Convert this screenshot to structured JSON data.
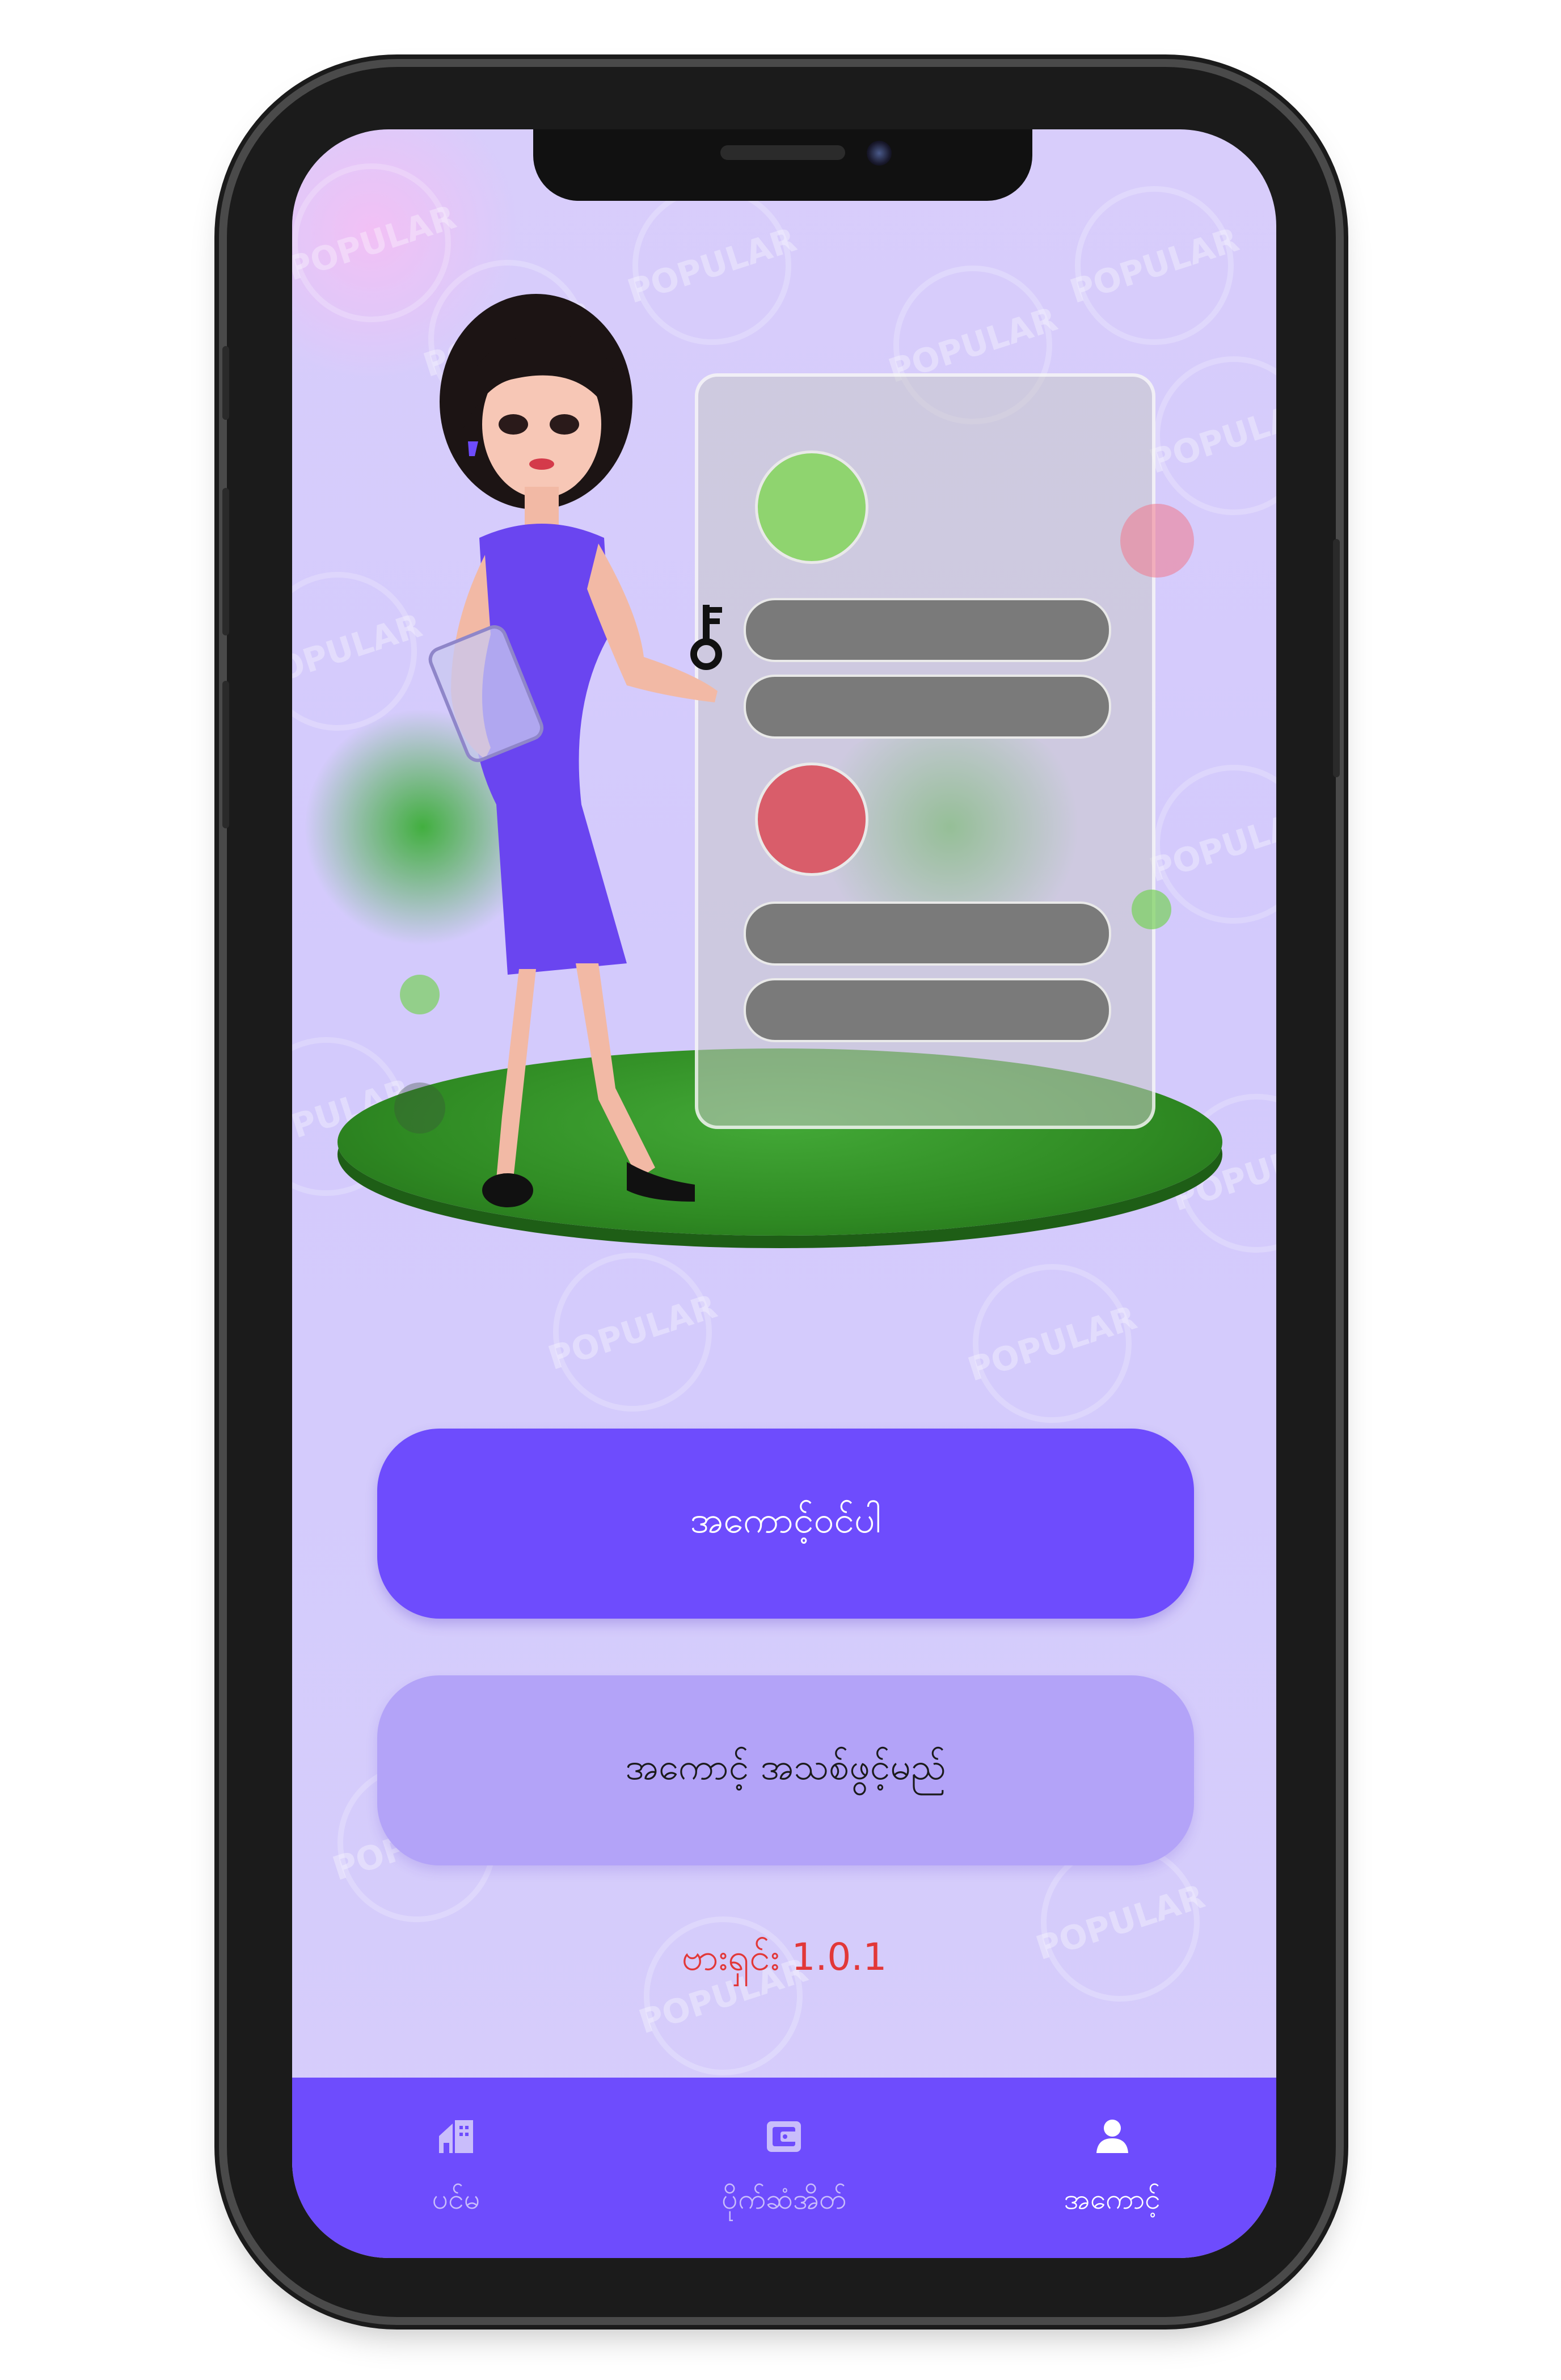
{
  "login": {
    "sign_in_label": "အကောင့်ဝင်ပါ",
    "register_label": "အကောင့် အသစ်ဖွင့်မည်",
    "version_label": "ဗားရှင်း  1.0.1"
  },
  "watermark": {
    "logo_text": "POPULAR"
  },
  "bottom_nav": {
    "items": [
      {
        "label": "ပင်မ",
        "icon": "home-icon",
        "active": false
      },
      {
        "label": "ပိုက်ဆံအိတ်",
        "icon": "wallet-icon",
        "active": false
      },
      {
        "label": "အကောင့်",
        "icon": "person-icon",
        "active": true
      }
    ]
  },
  "colors": {
    "primary": "#6e4cfd",
    "secondary": "#b3a3f8",
    "background": "#d6cdfb",
    "version_text": "#e23838",
    "nav_inactive": "#c9bdfb",
    "nav_active": "#ffffff"
  }
}
